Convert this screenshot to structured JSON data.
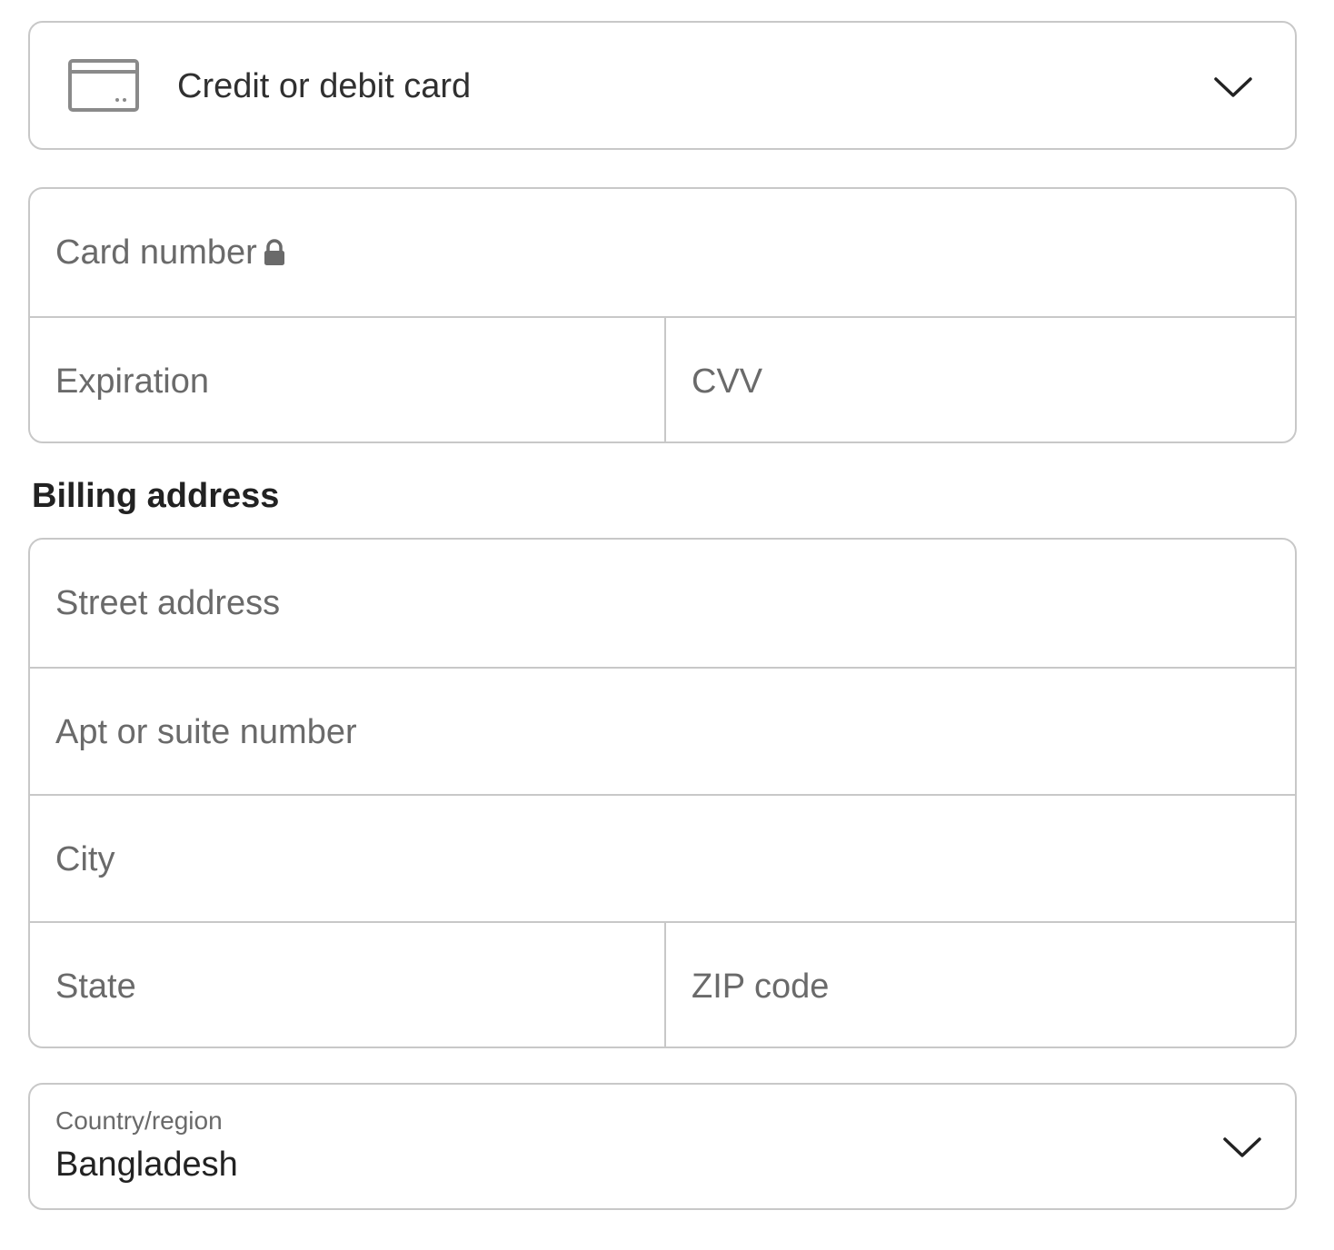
{
  "payment_method": {
    "icon": "credit-card-icon",
    "label": "Credit or debit card",
    "chevron_icon": "chevron-down-icon"
  },
  "card": {
    "number_placeholder": "Card number",
    "number_icon": "lock-icon",
    "expiration_placeholder": "Expiration",
    "cvv_placeholder": "CVV"
  },
  "billing": {
    "heading": "Billing address",
    "street_placeholder": "Street address",
    "apt_placeholder": "Apt or suite number",
    "city_placeholder": "City",
    "state_placeholder": "State",
    "zip_placeholder": "ZIP code"
  },
  "country": {
    "label": "Country/region",
    "value": "Bangladesh",
    "chevron_icon": "chevron-down-icon"
  },
  "colors": {
    "border": "#c8c8c8",
    "placeholder": "#6a6a6a",
    "text": "#222222"
  }
}
